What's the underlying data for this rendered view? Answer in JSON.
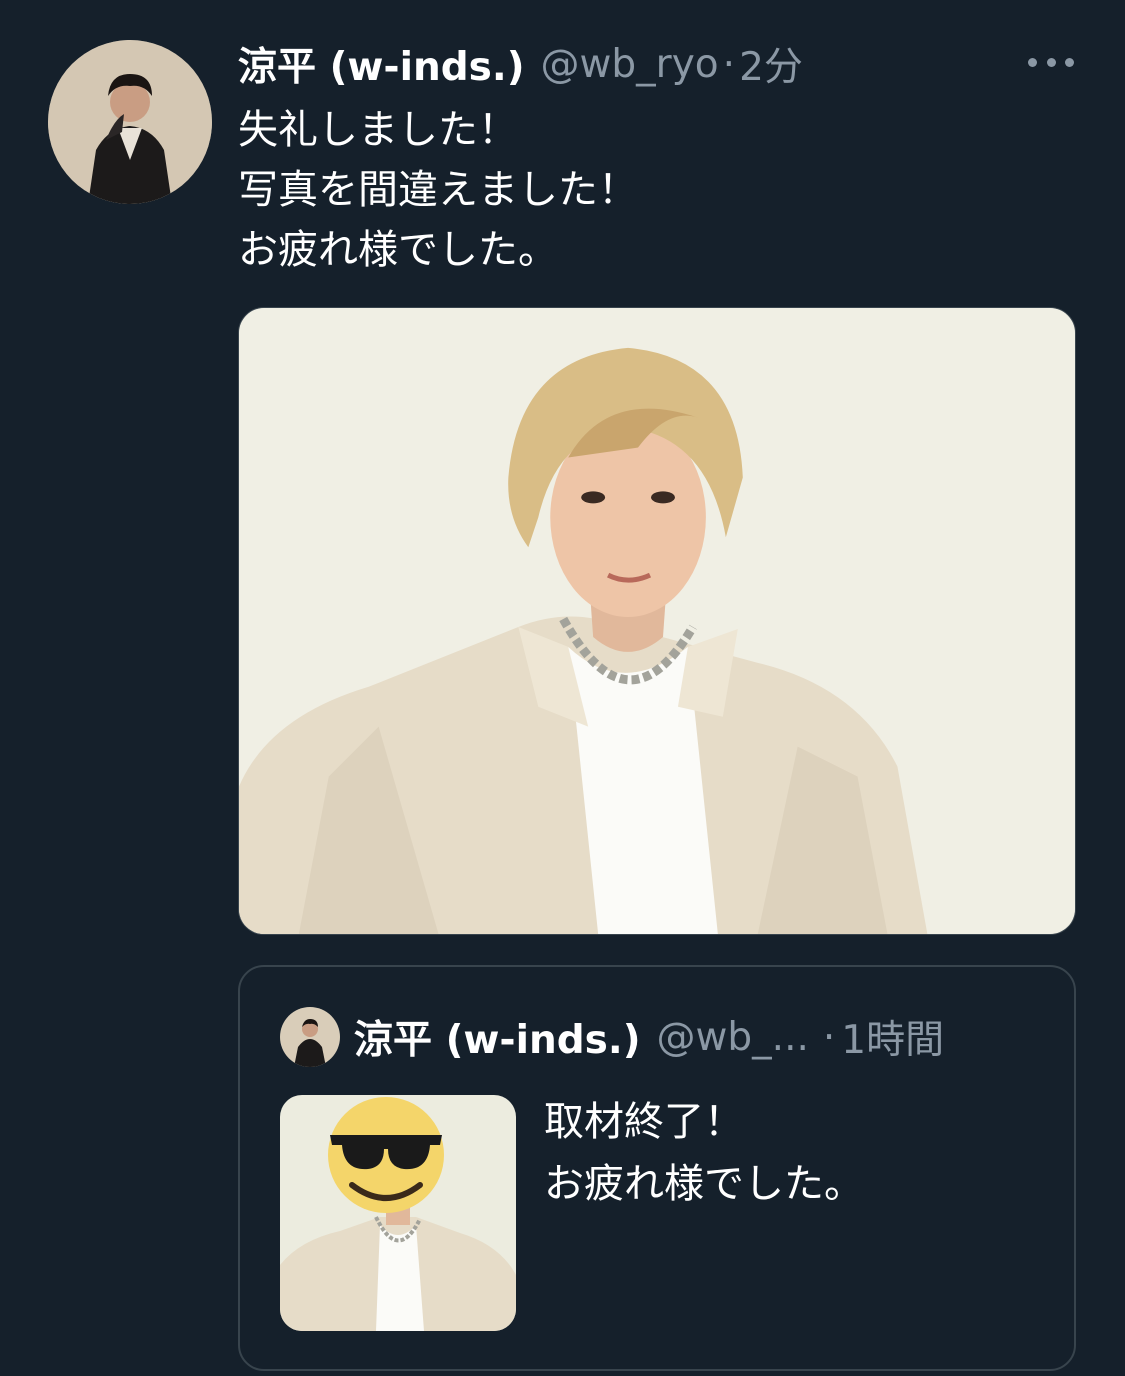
{
  "tweet": {
    "author_name": "涼平 (w-inds.)",
    "author_handle": "@wb_ryo",
    "separator": "·",
    "time": "2分",
    "more_icon": "more-horizontal-icon",
    "lines": [
      "失礼しました！",
      "写真を間違えました！",
      "お疲れ様でした。"
    ]
  },
  "quoted": {
    "author_name": "涼平 (w-inds.)",
    "author_handle": "@wb_...",
    "separator": "·",
    "time": "1時間",
    "lines": [
      "取材終了！",
      "お疲れ様でした。"
    ],
    "overlay_icon": "sunglasses-emoji-icon"
  },
  "colors": {
    "background": "#15202b",
    "text_primary": "#ffffff",
    "text_secondary": "#8b98a5",
    "border": "#38444d"
  }
}
